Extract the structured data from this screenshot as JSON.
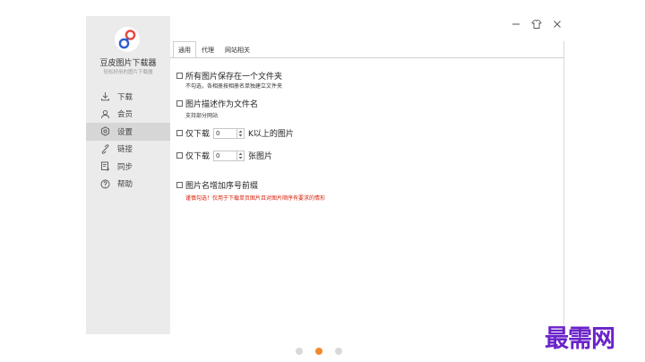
{
  "app": {
    "title": "豆皮图片下载器",
    "subtitle": "轻松好用的图片下载器"
  },
  "colors": {
    "accent": "#f08a2c",
    "sidebar_bg": "#ebebeb",
    "warning": "#d81e06",
    "watermark": "#6b23c9"
  },
  "sidebar": {
    "items": [
      {
        "label": "下载",
        "icon": "download-icon"
      },
      {
        "label": "会员",
        "icon": "user-icon"
      },
      {
        "label": "设置",
        "icon": "gear-icon",
        "active": true
      },
      {
        "label": "链接",
        "icon": "link-icon"
      },
      {
        "label": "同步",
        "icon": "sync-icon"
      },
      {
        "label": "帮助",
        "icon": "help-icon"
      }
    ]
  },
  "tabs": [
    {
      "label": "通用",
      "active": true
    },
    {
      "label": "代理",
      "active": false
    },
    {
      "label": "网站相关",
      "active": false
    }
  ],
  "settings": {
    "single_folder": {
      "label": "所有图片保存在一个文件夹",
      "note": "不勾选，各相册按相册名单独建立文件夹",
      "checked": false
    },
    "desc_as_filename": {
      "label": "图片描述作为文件名",
      "note": "支持部分网站",
      "checked": false
    },
    "min_size": {
      "prefix": "仅下载",
      "value": "0",
      "suffix": "K以上的图片",
      "checked": false
    },
    "max_count": {
      "prefix": "仅下载",
      "value": "0",
      "suffix": "张图片",
      "checked": false
    },
    "seq_prefix": {
      "label": "图片名增加序号前缀",
      "note": "谨慎勾选！仅用于下载单页图片且对图片顺序有要求的情形",
      "checked": false
    }
  },
  "pager": {
    "current": 2,
    "total": 3
  },
  "watermark": "最需网"
}
